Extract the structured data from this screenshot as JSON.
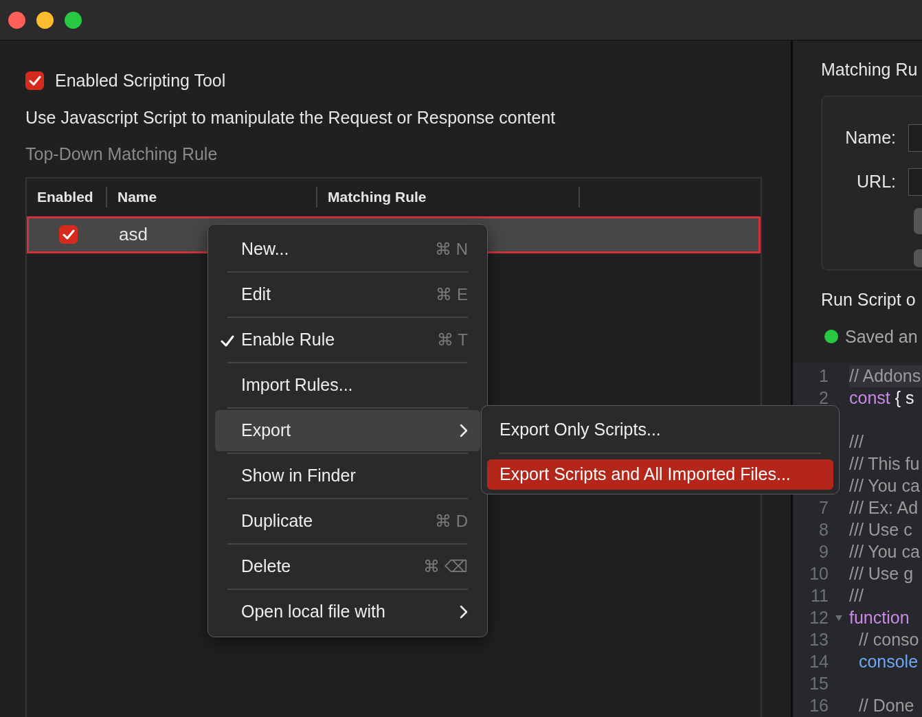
{
  "scripting": {
    "label": "Enabled Scripting Tool",
    "checked": true
  },
  "description": "Use Javascript Script to manipulate the Request or Response content",
  "section_title": "Top-Down Matching Rule",
  "table": {
    "columns": [
      "Enabled",
      "Name",
      "Matching Rule"
    ],
    "rows": [
      {
        "enabled": true,
        "name": "asd",
        "selected": true
      }
    ]
  },
  "context_menu": {
    "items": [
      {
        "label": "New...",
        "shortcut": "⌘ N",
        "checked": false,
        "has_submenu": false,
        "selected": false
      },
      {
        "label": "Edit",
        "shortcut": "⌘ E",
        "checked": false,
        "has_submenu": false,
        "selected": false
      },
      {
        "label": "Enable Rule",
        "shortcut": "⌘ T",
        "checked": true,
        "has_submenu": false,
        "selected": false
      },
      {
        "label": "Import Rules...",
        "checked": false,
        "has_submenu": false,
        "selected": false
      },
      {
        "label": "Export",
        "checked": false,
        "has_submenu": true,
        "selected": true
      },
      {
        "label": "Show in Finder",
        "checked": false,
        "has_submenu": false,
        "selected": false
      },
      {
        "label": "Duplicate",
        "shortcut": "⌘ D",
        "checked": false,
        "has_submenu": false,
        "selected": false
      },
      {
        "label": "Delete",
        "shortcut": "⌘ ⌫",
        "checked": false,
        "has_submenu": false,
        "selected": false
      },
      {
        "label": "Open local file with",
        "checked": false,
        "has_submenu": true,
        "selected": false
      }
    ]
  },
  "submenu": {
    "items": [
      {
        "label": "Export Only Scripts...",
        "selected": false
      },
      {
        "label": "Export Scripts and All Imported Files...",
        "selected": true
      }
    ]
  },
  "right_panel": {
    "title": "Matching Ru",
    "fields": [
      {
        "label": "Name:"
      },
      {
        "label": "URL:"
      }
    ],
    "run_title": "Run Script o",
    "status": "Saved an"
  },
  "code_editor": {
    "lines": [
      {
        "number": "1",
        "current": true,
        "tokens": [
          {
            "text": "// Addons",
            "kind": "comment"
          }
        ]
      },
      {
        "number": "2",
        "current": false,
        "tokens": [
          {
            "text": "const",
            "kind": "keyword"
          },
          {
            "text": " { s",
            "kind": "plain"
          }
        ]
      },
      {
        "current": false
      },
      {
        "current": false,
        "tokens": [
          {
            "text": "///",
            "kind": "comment"
          }
        ]
      },
      {
        "current": false,
        "tokens": [
          {
            "text": "/// This fu",
            "kind": "comment"
          }
        ]
      },
      {
        "current": false,
        "tokens": [
          {
            "text": "/// You ca",
            "kind": "comment"
          }
        ]
      },
      {
        "number": "7",
        "current": false,
        "tokens": [
          {
            "text": "/// Ex: Ad",
            "kind": "comment"
          }
        ]
      },
      {
        "number": "8",
        "current": false,
        "tokens": [
          {
            "text": "/// Use c",
            "kind": "comment"
          }
        ]
      },
      {
        "number": "9",
        "current": false,
        "tokens": [
          {
            "text": "/// You ca",
            "kind": "comment"
          }
        ]
      },
      {
        "number": "10",
        "current": false,
        "tokens": [
          {
            "text": "/// Use g",
            "kind": "comment"
          }
        ]
      },
      {
        "number": "11",
        "current": false,
        "tokens": [
          {
            "text": "///",
            "kind": "comment"
          }
        ]
      },
      {
        "number": "12",
        "current": false,
        "foldable": true,
        "tokens": [
          {
            "text": "function",
            "kind": "keyword"
          }
        ]
      },
      {
        "number": "13",
        "current": false,
        "tokens": [
          {
            "text": "  // conso",
            "kind": "comment"
          }
        ]
      },
      {
        "number": "14",
        "current": false,
        "tokens": [
          {
            "text": "  console",
            "kind": "call"
          }
        ]
      },
      {
        "number": "15",
        "current": false
      },
      {
        "number": "16",
        "current": false,
        "tokens": [
          {
            "text": "  // Done",
            "kind": "comment"
          }
        ]
      }
    ]
  }
}
